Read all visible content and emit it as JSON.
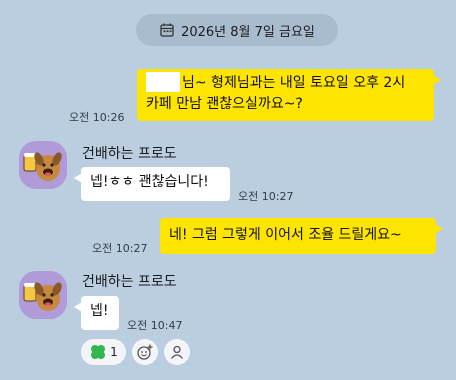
{
  "date_divider": {
    "text": "2026년 8월 7일 금요일",
    "icon": "calendar-icon"
  },
  "messages": [
    {
      "from": "me",
      "line1": "님~ 형제님과는 내일 토요일 오후 2시",
      "line2": "카페 만남 괜찮으실까요~?",
      "time": "오전 10:26"
    },
    {
      "from": "other",
      "sender": "건배하는 프로도",
      "text": "넵!ㅎㅎ 괜찮습니다!",
      "time": "오전 10:27"
    },
    {
      "from": "me",
      "text": "네! 그럼 그렇게 이어서 조율 드릴게요~",
      "time": "오전 10:27"
    },
    {
      "from": "other",
      "sender": "건배하는 프로도",
      "text": "넵!",
      "time": "오전 10:47"
    }
  ],
  "reactions": {
    "count": "1",
    "clover_color": "#2fb84f"
  },
  "colors": {
    "background": "#bacee0",
    "my_bubble": "#fee500",
    "other_bubble": "#ffffff",
    "avatar_bg": "#b09ad8"
  }
}
